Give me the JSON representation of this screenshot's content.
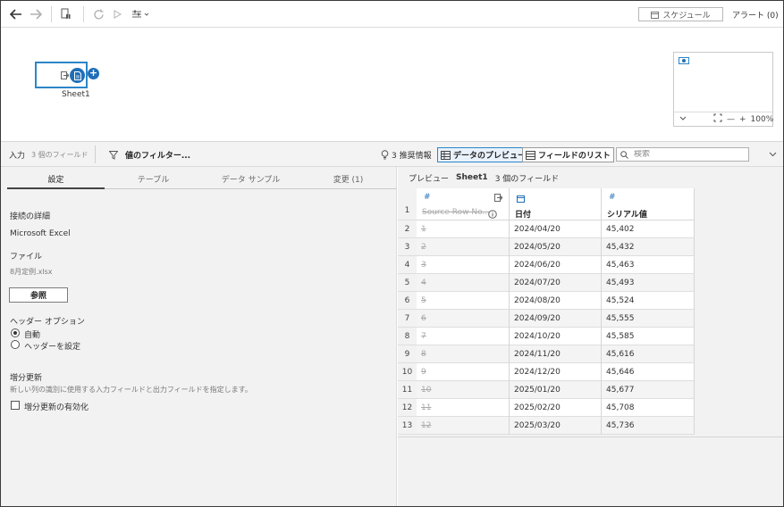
{
  "toolbar": {
    "schedule_label": "スケジュール",
    "alert_label": "アラート (0)"
  },
  "canvas": {
    "node_label": "Sheet1",
    "zoom": "100%"
  },
  "panelbar": {
    "input_label": "入力",
    "field_count": "3 個のフィールド",
    "filter_label": "値のフィルター...",
    "recommend_label": "3 推奨情報",
    "data_preview_label": "データのプレビュー",
    "field_list_label": "フィールドのリスト",
    "search_placeholder": "検索"
  },
  "left": {
    "tabs": [
      "設定",
      "テーブル",
      "データ サンプル",
      "変更 (1)"
    ],
    "connection_heading": "接続の詳細",
    "connection_value": "Microsoft Excel",
    "file_heading": "ファイル",
    "file_value": "8月定例.xlsx",
    "browse_label": "参照",
    "header_heading": "ヘッダー オプション",
    "header_auto": "自動",
    "header_set": "ヘッダーを設定",
    "incremental_heading": "増分更新",
    "incremental_desc": "新しい列の識別に使用する入力フィールドと出力フィールドを指定します。",
    "incremental_checkbox": "増分更新の有効化"
  },
  "preview": {
    "title": "プレビュー",
    "sheet": "Sheet1",
    "field_count": "3 個のフィールド",
    "columns": [
      {
        "type": "#",
        "name": "Source Row No..."
      },
      {
        "type": "date",
        "name": "日付"
      },
      {
        "type": "#",
        "name": "シリアル値"
      }
    ],
    "header_row_number": "1",
    "rows": [
      {
        "n": "2",
        "src": "1",
        "date": "2024/04/20",
        "serial": "45,402"
      },
      {
        "n": "3",
        "src": "2",
        "date": "2024/05/20",
        "serial": "45,432"
      },
      {
        "n": "4",
        "src": "3",
        "date": "2024/06/20",
        "serial": "45,463"
      },
      {
        "n": "5",
        "src": "4",
        "date": "2024/07/20",
        "serial": "45,493"
      },
      {
        "n": "6",
        "src": "5",
        "date": "2024/08/20",
        "serial": "45,524"
      },
      {
        "n": "7",
        "src": "6",
        "date": "2024/09/20",
        "serial": "45,555"
      },
      {
        "n": "8",
        "src": "7",
        "date": "2024/10/20",
        "serial": "45,585"
      },
      {
        "n": "9",
        "src": "8",
        "date": "2024/11/20",
        "serial": "45,616"
      },
      {
        "n": "10",
        "src": "9",
        "date": "2024/12/20",
        "serial": "45,646"
      },
      {
        "n": "11",
        "src": "10",
        "date": "2025/01/20",
        "serial": "45,677"
      },
      {
        "n": "12",
        "src": "11",
        "date": "2025/02/20",
        "serial": "45,708"
      },
      {
        "n": "13",
        "src": "12",
        "date": "2025/03/20",
        "serial": "45,736"
      }
    ]
  }
}
